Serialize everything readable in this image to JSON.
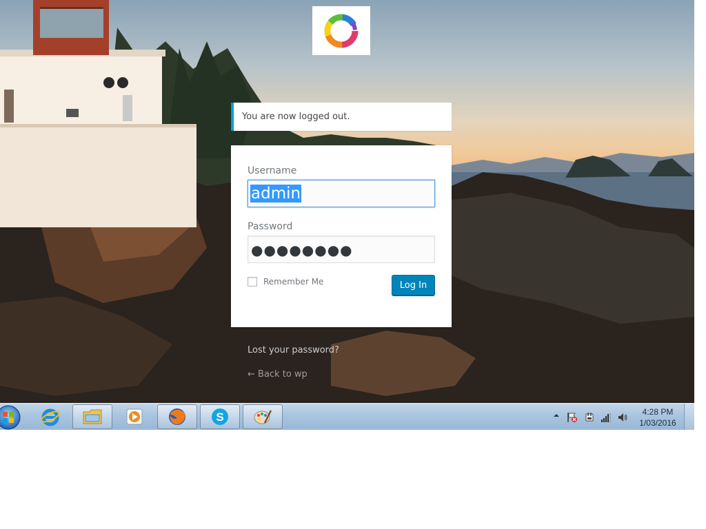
{
  "login": {
    "notice": "You are now logged out.",
    "username_label": "Username",
    "username_value": "admin",
    "password_label": "Password",
    "password_masked": "●●●●●●●●",
    "remember_label": "Remember Me",
    "login_button": "Log In",
    "lost_password_link": "Lost your password?",
    "back_link": "← Back to wp"
  },
  "taskbar": {
    "pinned": [
      {
        "name": "internet-explorer-icon"
      },
      {
        "name": "file-explorer-icon"
      },
      {
        "name": "media-player-icon"
      },
      {
        "name": "firefox-icon"
      },
      {
        "name": "skype-icon"
      },
      {
        "name": "paint-icon"
      }
    ],
    "clock_time": "4:28 PM",
    "clock_date": "1/03/2016"
  },
  "colors": {
    "primary_button": "#0085ba",
    "notice_accent": "#00a0d2",
    "selection": "#3399ff"
  }
}
